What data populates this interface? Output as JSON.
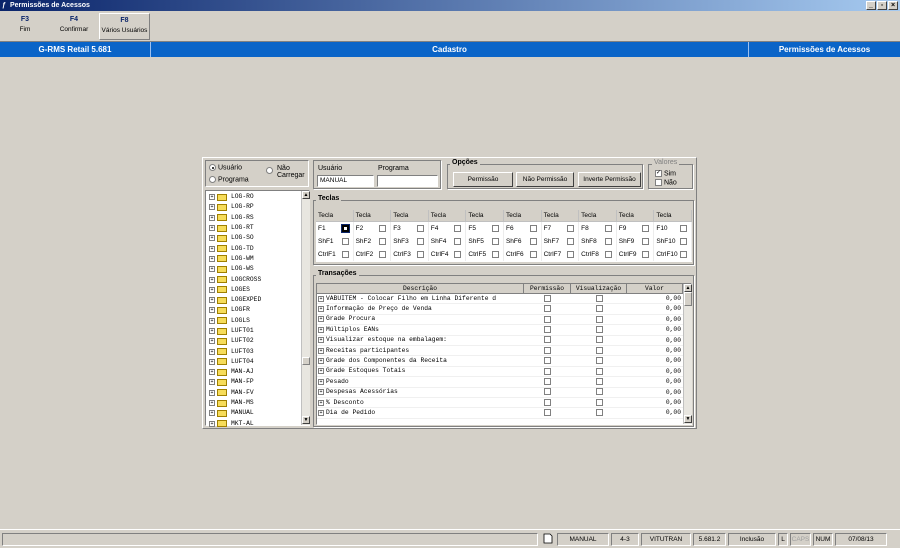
{
  "window": {
    "title": "Permissões de Acessos",
    "buttons": [
      "_",
      "▫",
      "×"
    ]
  },
  "toolbar": {
    "keys": [
      {
        "key": "F3",
        "label": "Fim"
      },
      {
        "key": "F4",
        "label": "Confirmar"
      },
      {
        "key": "F8",
        "label": "Vários Usuários"
      }
    ]
  },
  "header": {
    "left": "G-RMS Retail 5.681",
    "center": "Cadastro",
    "right": "Permissões de Acessos"
  },
  "mode": {
    "usuario": "Usuário",
    "programa": "Programa",
    "nao_carregar_1": "Não",
    "nao_carregar_2": "Carregar",
    "selected": "usuario"
  },
  "fields": {
    "usuario_label": "Usuário",
    "usuario_value": "MANUAL",
    "programa_label": "Programa",
    "programa_value": ""
  },
  "opcoes": {
    "title": "Opções",
    "permissao": "Permissão",
    "nao_permissao": "Não Permissão",
    "inverte": "Inverte Permissão"
  },
  "valores": {
    "title": "Valores",
    "sim": "Sim",
    "nao": "Não",
    "sim_checked": true,
    "nao_checked": false
  },
  "tree": {
    "items": [
      "LOG-RO",
      "LOG-RP",
      "LOG-RS",
      "LOG-RT",
      "LOG-SO",
      "LOG-TD",
      "LOG-WM",
      "LOG-WS",
      "LOGCROSS",
      "LOGES",
      "LOGEXPED",
      "LOGFR",
      "LOGLS",
      "LUFT01",
      "LUFT02",
      "LUFT03",
      "LUFT04",
      "MAN-AJ",
      "MAN-FP",
      "MAN-FV",
      "MAN-MS",
      "MANUAL",
      "MKT-AL"
    ]
  },
  "teclas": {
    "title": "Teclas",
    "header": "Tecla",
    "rows": [
      [
        "F1",
        "F2",
        "F3",
        "F4",
        "F5",
        "F6",
        "F7",
        "F8",
        "F9",
        "F10"
      ],
      [
        "ShF1",
        "ShF2",
        "ShF3",
        "ShF4",
        "ShF5",
        "ShF6",
        "ShF7",
        "ShF8",
        "ShF9",
        "ShF10"
      ],
      [
        "CtrlF1",
        "CtrlF2",
        "CtrlF3",
        "CtrlF4",
        "CtrlF5",
        "CtrlF6",
        "CtrlF7",
        "CtrlF8",
        "CtrlF9",
        "CtrlF10"
      ]
    ]
  },
  "transacoes": {
    "title": "Transações",
    "columns": [
      "Descrição",
      "Permissão",
      "Visualização",
      "Valor"
    ],
    "rows": [
      {
        "desc": "VABUITEM - Colocar Filho em Linha Diferente d",
        "valor": "0,00"
      },
      {
        "desc": "Informação de Preço de Venda",
        "valor": "0,00"
      },
      {
        "desc": "Grade Procura",
        "valor": "0,00"
      },
      {
        "desc": "Múltiplos EANs",
        "valor": "0,00"
      },
      {
        "desc": "Visualizar estoque na embalagem:",
        "valor": "0,00"
      },
      {
        "desc": "Receitas participantes",
        "valor": "0,00"
      },
      {
        "desc": "Grade dos Componentes da Receita",
        "valor": "0,00"
      },
      {
        "desc": "Grade Estoques Totais",
        "valor": "0,00"
      },
      {
        "desc": "Pesado",
        "valor": "0,00"
      },
      {
        "desc": "Despesas Acessórias",
        "valor": "0,00"
      },
      {
        "desc": "% Desconto",
        "valor": "0,00"
      },
      {
        "desc": "Dia de Pedido",
        "valor": "0,00"
      }
    ]
  },
  "status": {
    "user": "MANUAL",
    "code": "4-3",
    "company": "VITUTRAN",
    "version": "5.681.2",
    "mode": "Inclusão",
    "l": "L",
    "caps": "CAPS",
    "num": "NUM",
    "date": "07/08/13"
  }
}
